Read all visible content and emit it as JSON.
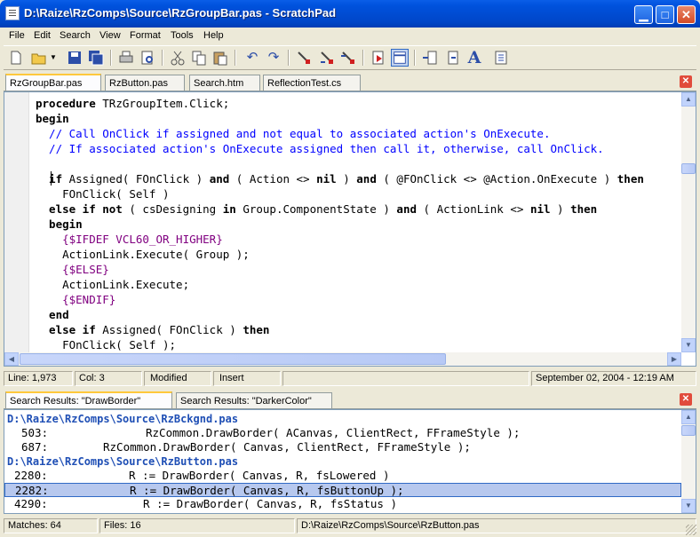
{
  "window": {
    "title": "D:\\Raize\\RzComps\\Source\\RzGroupBar.pas - ScratchPad"
  },
  "menu": [
    "File",
    "Edit",
    "Search",
    "View",
    "Format",
    "Tools",
    "Help"
  ],
  "editor_tabs": [
    "RzGroupBar.pas",
    "RzButton.pas",
    "Search.htm",
    "ReflectionTest.cs"
  ],
  "code": {
    "l1": {
      "a": "procedure ",
      "b": "TRzGroupItem.Click;"
    },
    "l2": "begin",
    "l3": "  // Call OnClick if assigned and not equal to associated action's OnExecute.",
    "l4": "  // If associated action's OnExecute assigned then call it, otherwise, call OnClick.",
    "l6": {
      "a": "  if",
      "b": " Assigned( FOnClick ) ",
      "c": "and",
      "d": " ( Action <> ",
      "e": "nil",
      "f": " ) ",
      "g": "and",
      "h": " ( @FOnClick <> @Action.OnExecute ) ",
      "i": "then"
    },
    "l7": "    FOnClick( Self )",
    "l8": {
      "a": "  else if not",
      "b": " ( csDesigning ",
      "c": "in",
      "d": " Group.ComponentState ) ",
      "e": "and",
      "f": " ( ActionLink <> ",
      "g": "nil",
      "h": " ) ",
      "i": "then"
    },
    "l9": "  begin",
    "l10": "    {$IFDEF VCL60_OR_HIGHER}",
    "l11": "    ActionLink.Execute( Group );",
    "l12": "    {$ELSE}",
    "l13": "    ActionLink.Execute;",
    "l14": "    {$ENDIF}",
    "l15": "  end",
    "l16": {
      "a": "  else if",
      "b": " Assigned( FOnClick ) ",
      "c": "then"
    },
    "l17": "    FOnClick( Self );"
  },
  "status": {
    "line": "Line: 1,973",
    "col": "Col: 3",
    "modified": "Modified",
    "mode": "Insert",
    "datetime": "September 02, 2004 - 12:19 AM"
  },
  "result_tabs": [
    "Search Results: \"DrawBorder\"",
    "Search Results: \"DarkerColor\""
  ],
  "results": {
    "file1": "D:\\Raize\\RzComps\\Source\\RzBckgnd.pas",
    "r1": {
      "num": "503:",
      "text": "RzCommon.DrawBorder( ACanvas, ClientRect, FFrameStyle );"
    },
    "r2": {
      "num": "687:",
      "text": "RzCommon.DrawBorder( Canvas, ClientRect, FFrameStyle );"
    },
    "file2": "D:\\Raize\\RzComps\\Source\\RzButton.pas",
    "r3": {
      "num": "2280:",
      "text": "R := DrawBorder( Canvas, R, fsLowered )"
    },
    "r4": {
      "num": "2282:",
      "text": "R := DrawBorder( Canvas, R, fsButtonUp );"
    },
    "r5": {
      "num": "4290:",
      "text": "R := DrawBorder( Canvas, R, fsStatus )"
    }
  },
  "bottom_status": {
    "matches": "Matches: 64",
    "files": "Files: 16",
    "path": "D:\\Raize\\RzComps\\Source\\RzButton.pas"
  }
}
